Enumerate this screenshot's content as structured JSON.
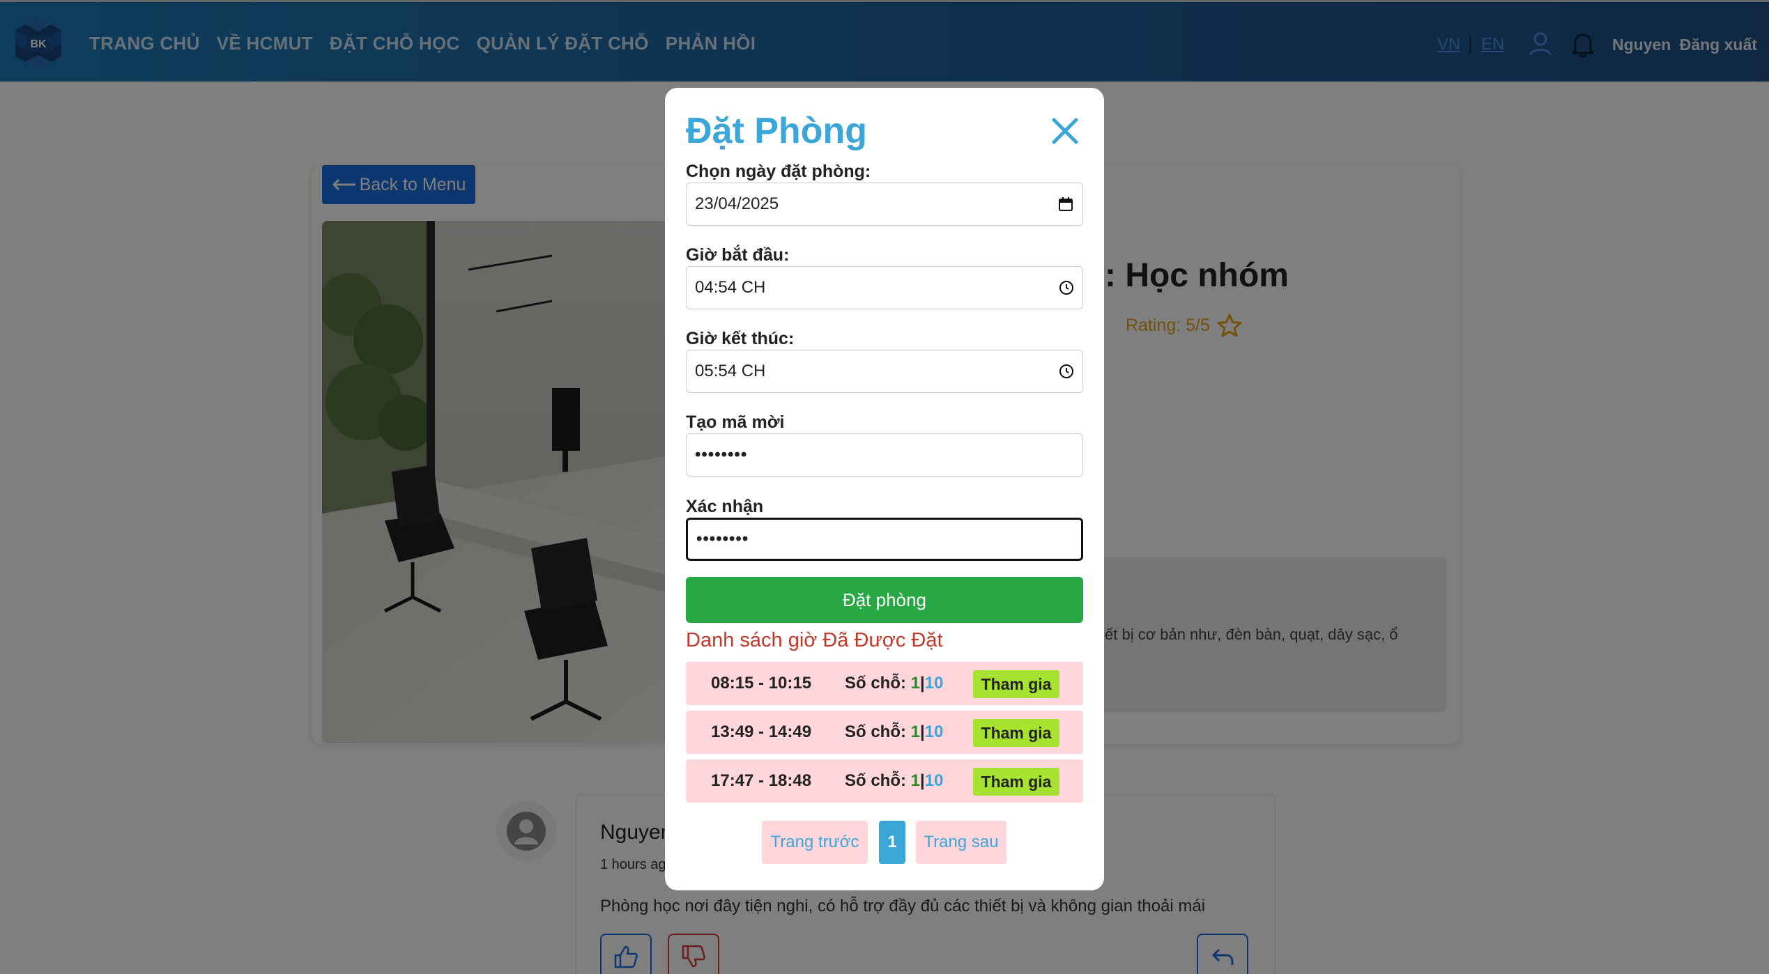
{
  "nav": {
    "logo_text": "BK",
    "links": [
      "TRANG CHỦ",
      "VỀ HCMUT",
      "ĐẶT CHỖ HỌC",
      "QUẢN LÝ ĐẶT CHỖ",
      "PHẢN HỒI"
    ],
    "lang_vn": "VN",
    "lang_sep": "|",
    "lang_en": "EN",
    "user_name": "Nguyen",
    "logout": "Đăng xuất"
  },
  "page": {
    "back_label": "Back to Menu",
    "room_title_visible": ": Học nhóm",
    "rating_text": "Rating: 5/5",
    "desc_visible": "ết bị cơ bản như, đèn bàn, quạt, dây sạc, ổ"
  },
  "comment": {
    "author_visible": "Nguyen",
    "time_visible": "1 hours ag",
    "body": "Phòng học nơi đây tiện nghi, có hỗ trợ đầy đủ các thiết bị và không gian thoải mái"
  },
  "modal": {
    "title": "Đặt Phòng",
    "date_label": "Chọn ngày đặt phòng:",
    "date_value": "23/04/2025",
    "start_label": "Giờ bắt đầu:",
    "start_value": "04:54  CH",
    "end_label": "Giờ kết thúc:",
    "end_value": "05:54  CH",
    "code_label": "Tạo mã mời",
    "code_value": "••••••••",
    "confirm_label": "Xác nhận",
    "confirm_value": "••••••••",
    "submit": "Đặt phòng",
    "booked_title": "Danh sách giờ Đã Được Đặt",
    "seats_label": "Số chỗ: ",
    "join_label": "Tham gia",
    "slots": [
      {
        "time": "08:15 - 10:15",
        "used": "1",
        "sep": "|",
        "max": "10"
      },
      {
        "time": "13:49 - 14:49",
        "used": "1",
        "sep": "|",
        "max": "10"
      },
      {
        "time": "17:47 - 18:48",
        "used": "1",
        "sep": "|",
        "max": "10"
      }
    ],
    "prev": "Trang trước",
    "page": "1",
    "next": "Trang sau"
  }
}
